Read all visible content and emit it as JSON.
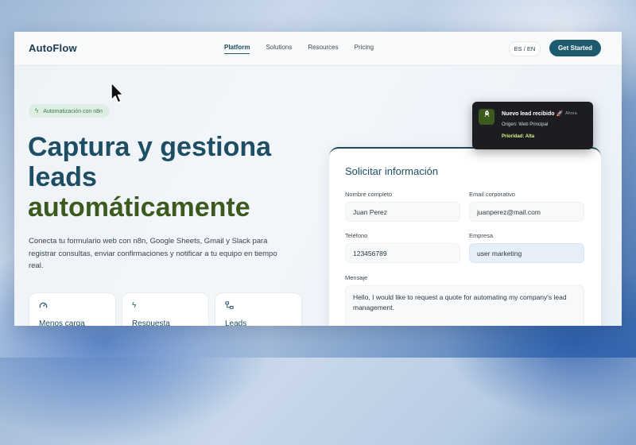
{
  "nav": {
    "logo": "AutoFlow",
    "items": [
      {
        "label": "Platform",
        "active": true
      },
      {
        "label": "Solutions",
        "active": false
      },
      {
        "label": "Resources",
        "active": false
      },
      {
        "label": "Pricing",
        "active": false
      }
    ],
    "language": "ES / EN",
    "cta": "Get Started"
  },
  "hero": {
    "badge": "Automatización con n8n",
    "badge_icon": "bolt-icon",
    "title_line1": "Captura y gestiona",
    "title_line2": "leads",
    "title_line3": "automáticamente",
    "description": "Conecta tu formulario web con n8n, Google Sheets, Gmail y Slack para registrar consultas, enviar confirmaciones y notificar a tu equipo en tiempo real."
  },
  "features": [
    {
      "icon": "gauge-icon",
      "title": "Menos carga"
    },
    {
      "icon": "bolt-icon",
      "title": "Respuesta"
    },
    {
      "icon": "workflow-icon",
      "title": "Leads"
    }
  ],
  "form": {
    "title": "Solicitar información",
    "name_label": "Nombre completo",
    "name_value": "Juan Perez",
    "email_label": "Email corporativo",
    "email_value": "juanperez@mail.com",
    "phone_label": "Teléfono",
    "phone_value": "123456789",
    "company_label": "Empresa",
    "company_value": "user marketing",
    "message_label": "Mensaje",
    "message_value": "Hello, I would like to request a quote for automating my company's lead management."
  },
  "toast": {
    "icon": "rocket-icon",
    "title": "Nuevo lead recibido 🚀",
    "time": "Ahora",
    "origin": "Origen: Web Principal",
    "priority": "Prioridad: Alta"
  },
  "colors": {
    "primary": "#1e5a6e",
    "accent_green": "#3d5a1e",
    "toast_bg": "#1b1d20",
    "priority": "#d9f08a"
  }
}
